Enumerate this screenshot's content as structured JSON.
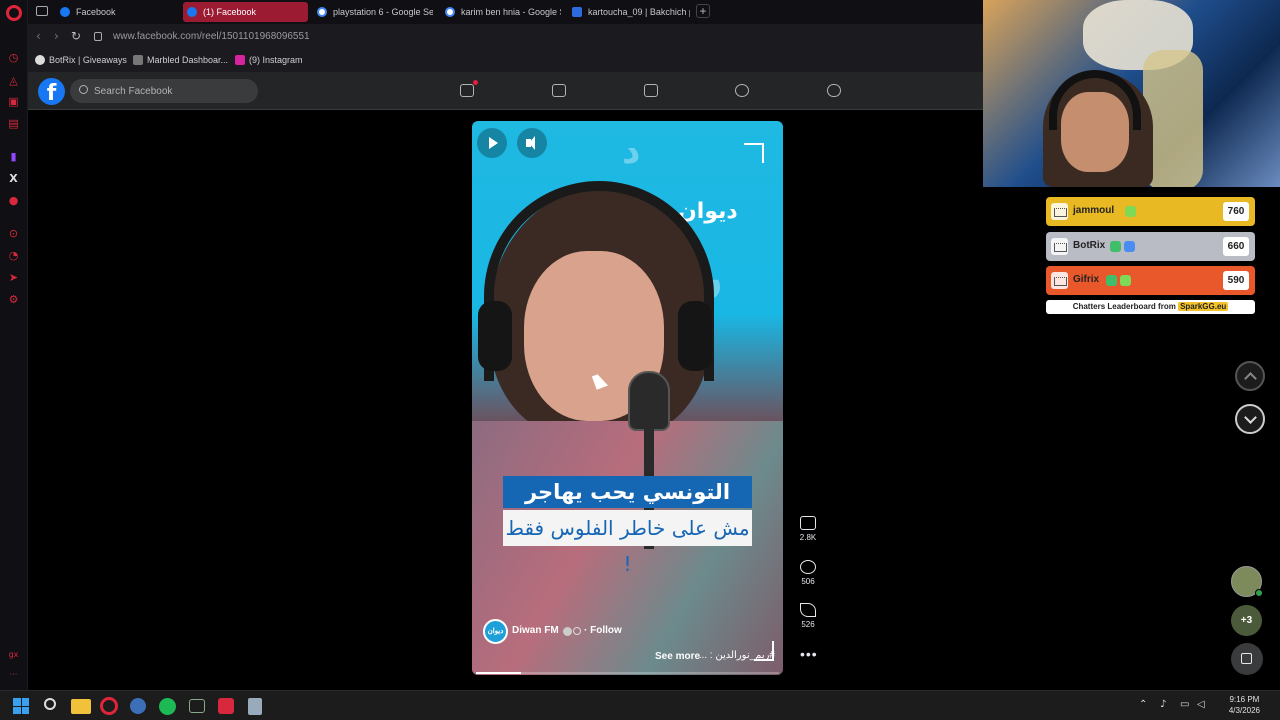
{
  "browser": {
    "tabs": [
      {
        "label": "Facebook",
        "favicon": "facebook-icon",
        "active": false
      },
      {
        "label": "(1) Facebook",
        "favicon": "facebook-icon",
        "active": true
      },
      {
        "label": "playstation 6 - Google Se",
        "favicon": "google-icon",
        "active": false
      },
      {
        "label": "karim ben hnia - Google S",
        "favicon": "google-icon",
        "active": false
      },
      {
        "label": "kartoucha_09 | Bakchich p",
        "favicon": "kick-icon",
        "active": false
      }
    ],
    "new_tab": "+",
    "url": "www.facebook.com/reel/1501101968096551",
    "bookmarks": [
      {
        "label": "BotRix | Giveaways",
        "icon": "botrix-icon"
      },
      {
        "label": "Marbled Dashboar...",
        "icon": "dashboard-icon"
      },
      {
        "label": "(9) Instagram",
        "icon": "instagram-icon"
      }
    ]
  },
  "facebook": {
    "logo": "f",
    "search_placeholder": "Search Facebook",
    "nav_icons": [
      "home-icon",
      "video-icon",
      "marketplace-icon",
      "groups-icon",
      "gaming-icon"
    ]
  },
  "reel": {
    "brand_logo": "ديوان",
    "caption_line1": "التونسي يحب يهاجر",
    "caption_line2": "مش على خاطر الفلوس فقط !",
    "author": "Diwan FM",
    "author_avatar_text": "ديوان",
    "follow": "· Follow",
    "description": "#ريم_نورالدين : ...",
    "see_more": "See more",
    "progress": 0.15,
    "actions": {
      "likes": "2.8K",
      "comments": "506",
      "shares": "526"
    }
  },
  "leaderboard": {
    "rows": [
      {
        "name": "jammoul",
        "score": "760",
        "color": "#e8b923"
      },
      {
        "name": "BotRix",
        "score": "660",
        "color": "#b9bcc4"
      },
      {
        "name": "Gifrix",
        "score": "590",
        "color": "#e8582a"
      }
    ],
    "footer_prefix": "Chatters Leaderboard from",
    "footer_brand": "SparkGG.eu"
  },
  "chat": {
    "more_count": "+3"
  },
  "taskbar": {
    "time": "9:16 PM",
    "date": "4/3/2026"
  }
}
